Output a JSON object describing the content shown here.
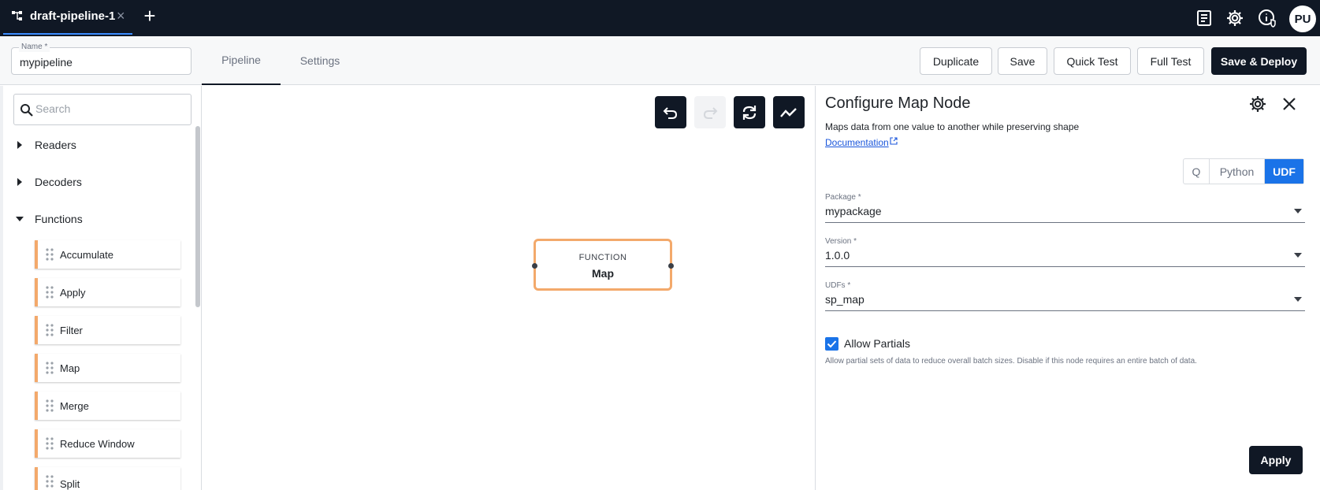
{
  "topbar": {
    "tab_title": "draft-pipeline-1",
    "tab_close": "×",
    "add_tab": "+",
    "avatar_initials": "PU",
    "icons": [
      "pipeline-icon",
      "document-list-icon",
      "gear-icon",
      "info-shield-icon"
    ]
  },
  "header": {
    "name_label": "Name *",
    "name_value": "mypipeline",
    "tabs": [
      {
        "label": "Pipeline",
        "active": true
      },
      {
        "label": "Settings",
        "active": false
      }
    ],
    "buttons": {
      "duplicate": "Duplicate",
      "save": "Save",
      "quick_test": "Quick Test",
      "full_test": "Full Test",
      "save_deploy": "Save & Deploy"
    }
  },
  "sidebar": {
    "search_placeholder": "Search",
    "categories": [
      {
        "label": "Readers",
        "expanded": false
      },
      {
        "label": "Decoders",
        "expanded": false
      },
      {
        "label": "Functions",
        "expanded": true
      }
    ],
    "functions": [
      "Accumulate",
      "Apply",
      "Filter",
      "Map",
      "Merge",
      "Reduce Window",
      "Split"
    ]
  },
  "canvas": {
    "toolbar_icons": [
      "undo-icon",
      "redo-icon",
      "refresh-icon",
      "chart-line-icon"
    ],
    "node": {
      "type": "FUNCTION",
      "name": "Map"
    }
  },
  "config": {
    "title": "Configure Map Node",
    "description": "Maps data from one value to another while preserving shape",
    "doc_link": "Documentation",
    "languages": [
      {
        "label": "Q",
        "active": false
      },
      {
        "label": "Python",
        "active": false
      },
      {
        "label": "UDF",
        "active": true
      }
    ],
    "fields": {
      "package": {
        "label": "Package *",
        "value": "mypackage"
      },
      "version": {
        "label": "Version *",
        "value": "1.0.0"
      },
      "udfs": {
        "label": "UDFs *",
        "value": "sp_map"
      }
    },
    "allow_partials": {
      "label": "Allow Partials",
      "checked": true,
      "help": "Allow partial sets of data to reduce overall batch sizes. Disable if this node requires an entire batch of data."
    },
    "apply_label": "Apply"
  },
  "colors": {
    "topbar_bg": "#101825",
    "accent_blue": "#1a73e8",
    "node_border": "#f3a96b",
    "primary_dark": "#101825"
  }
}
